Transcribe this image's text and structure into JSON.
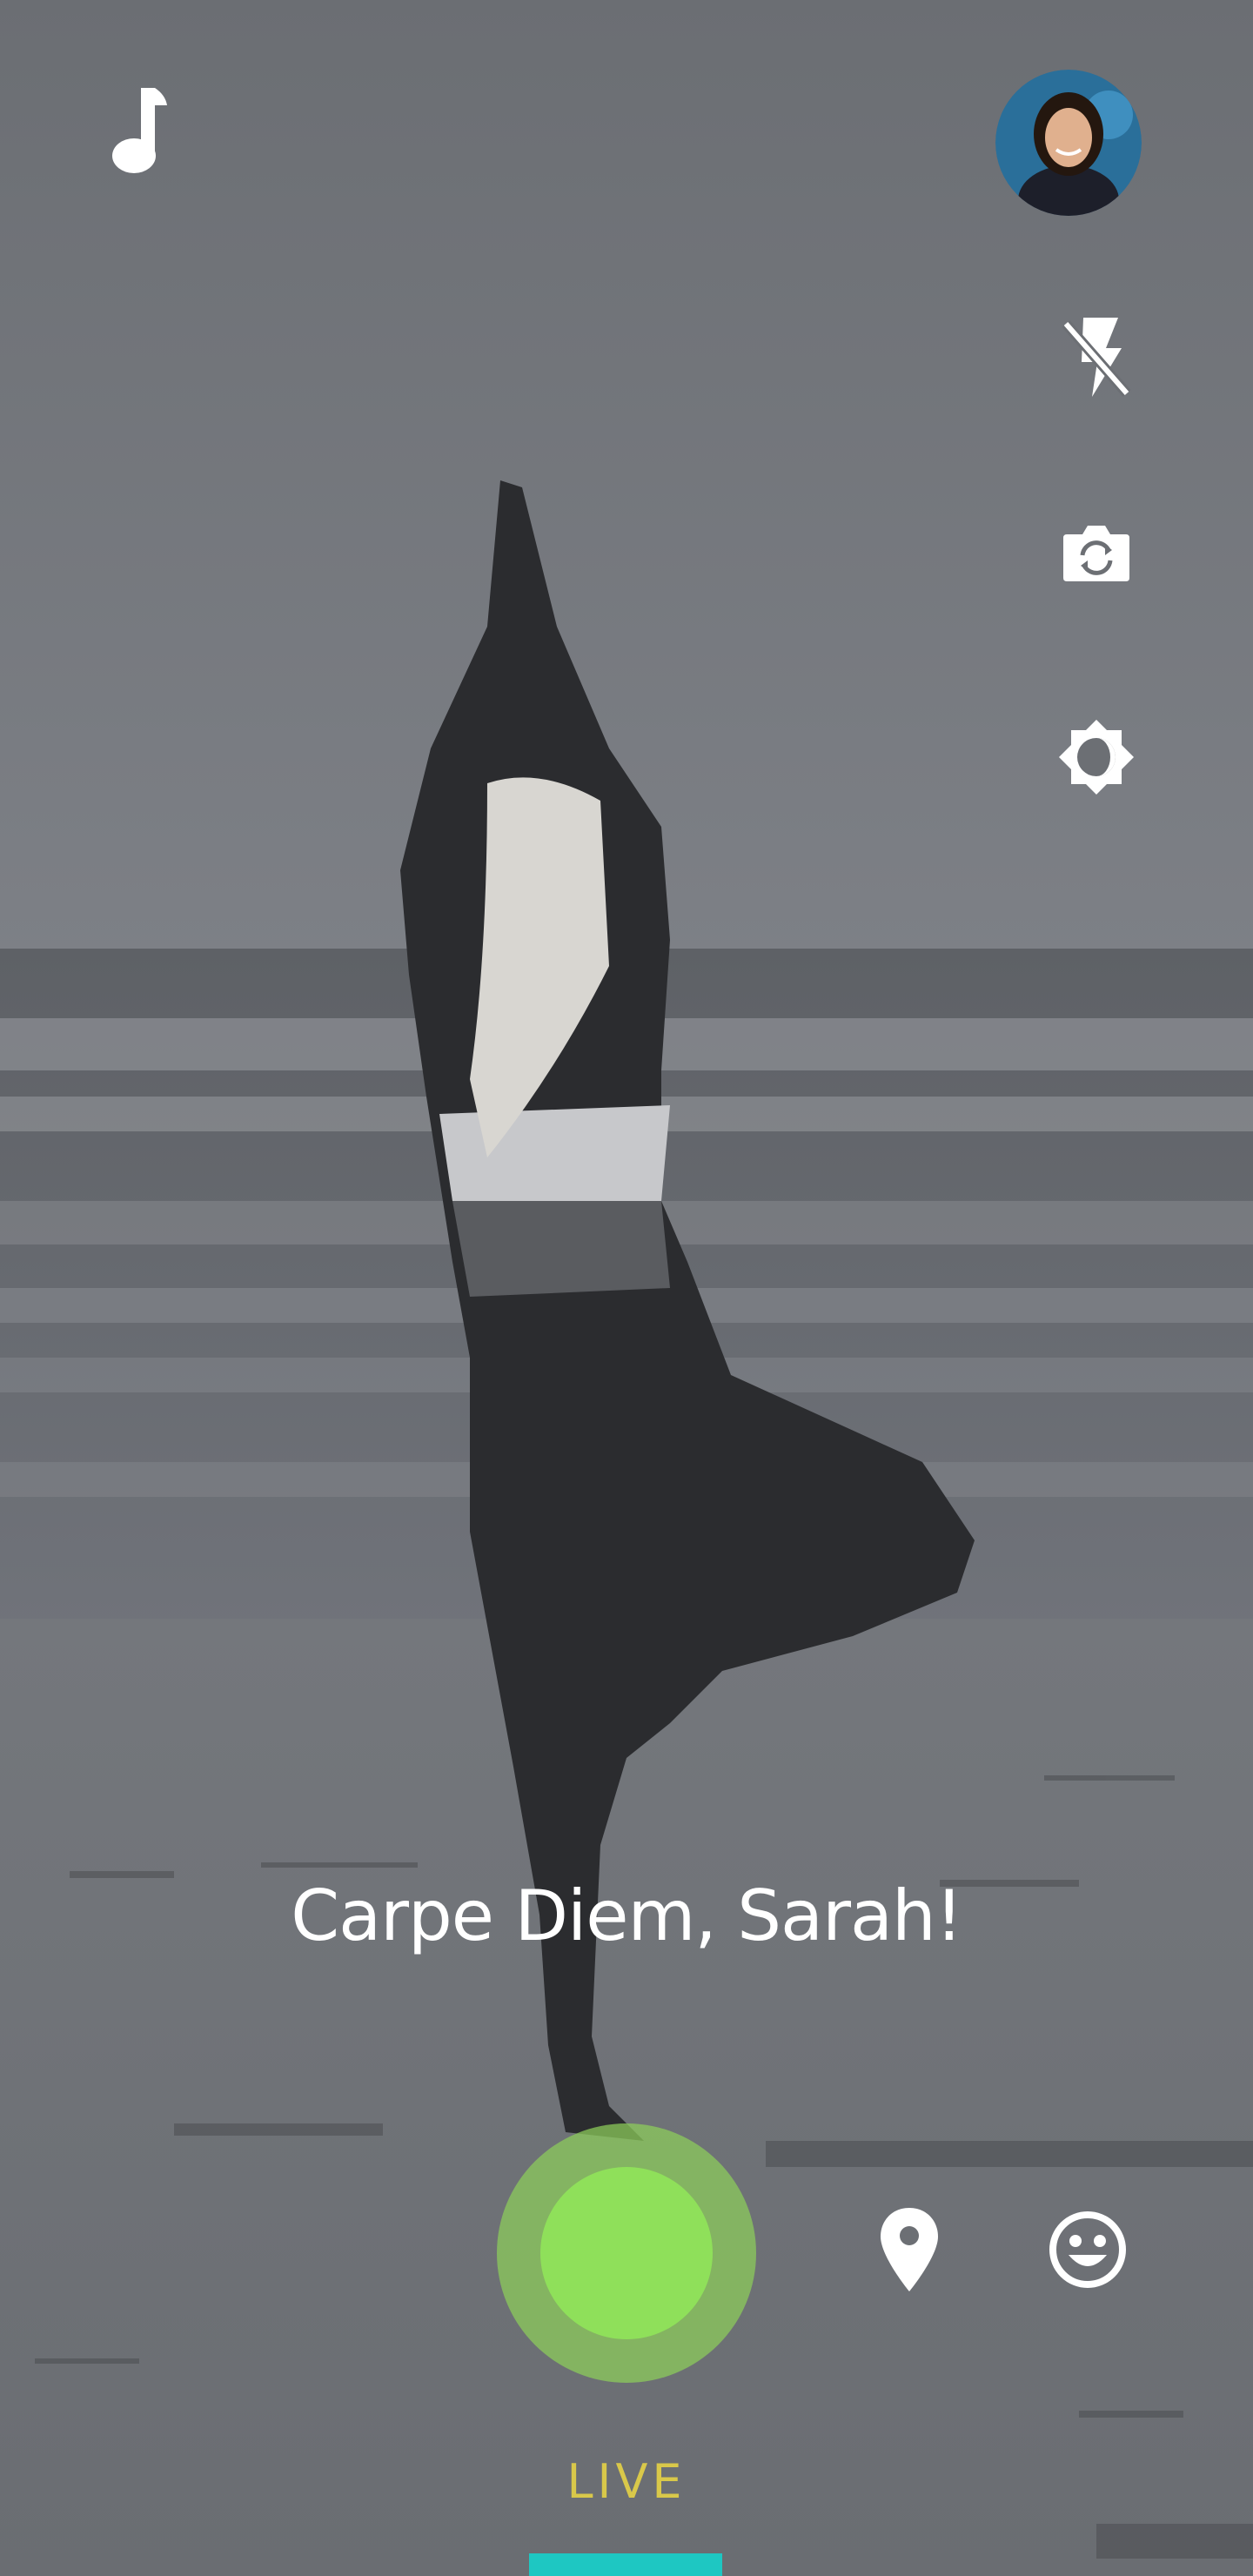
{
  "greeting": "Carpe Diem, Sarah!",
  "mode": {
    "label": "LIVE"
  },
  "icons": {
    "music": "music-note-icon",
    "flash": "flash-off-icon",
    "flip_camera": "flip-camera-icon",
    "brightness": "brightness-icon",
    "location": "location-pin-icon",
    "emoji": "emoji-icon"
  },
  "colors": {
    "capture": "#8fe05a",
    "mode_label": "#d9c84a",
    "mode_indicator": "#1ec7c2"
  }
}
